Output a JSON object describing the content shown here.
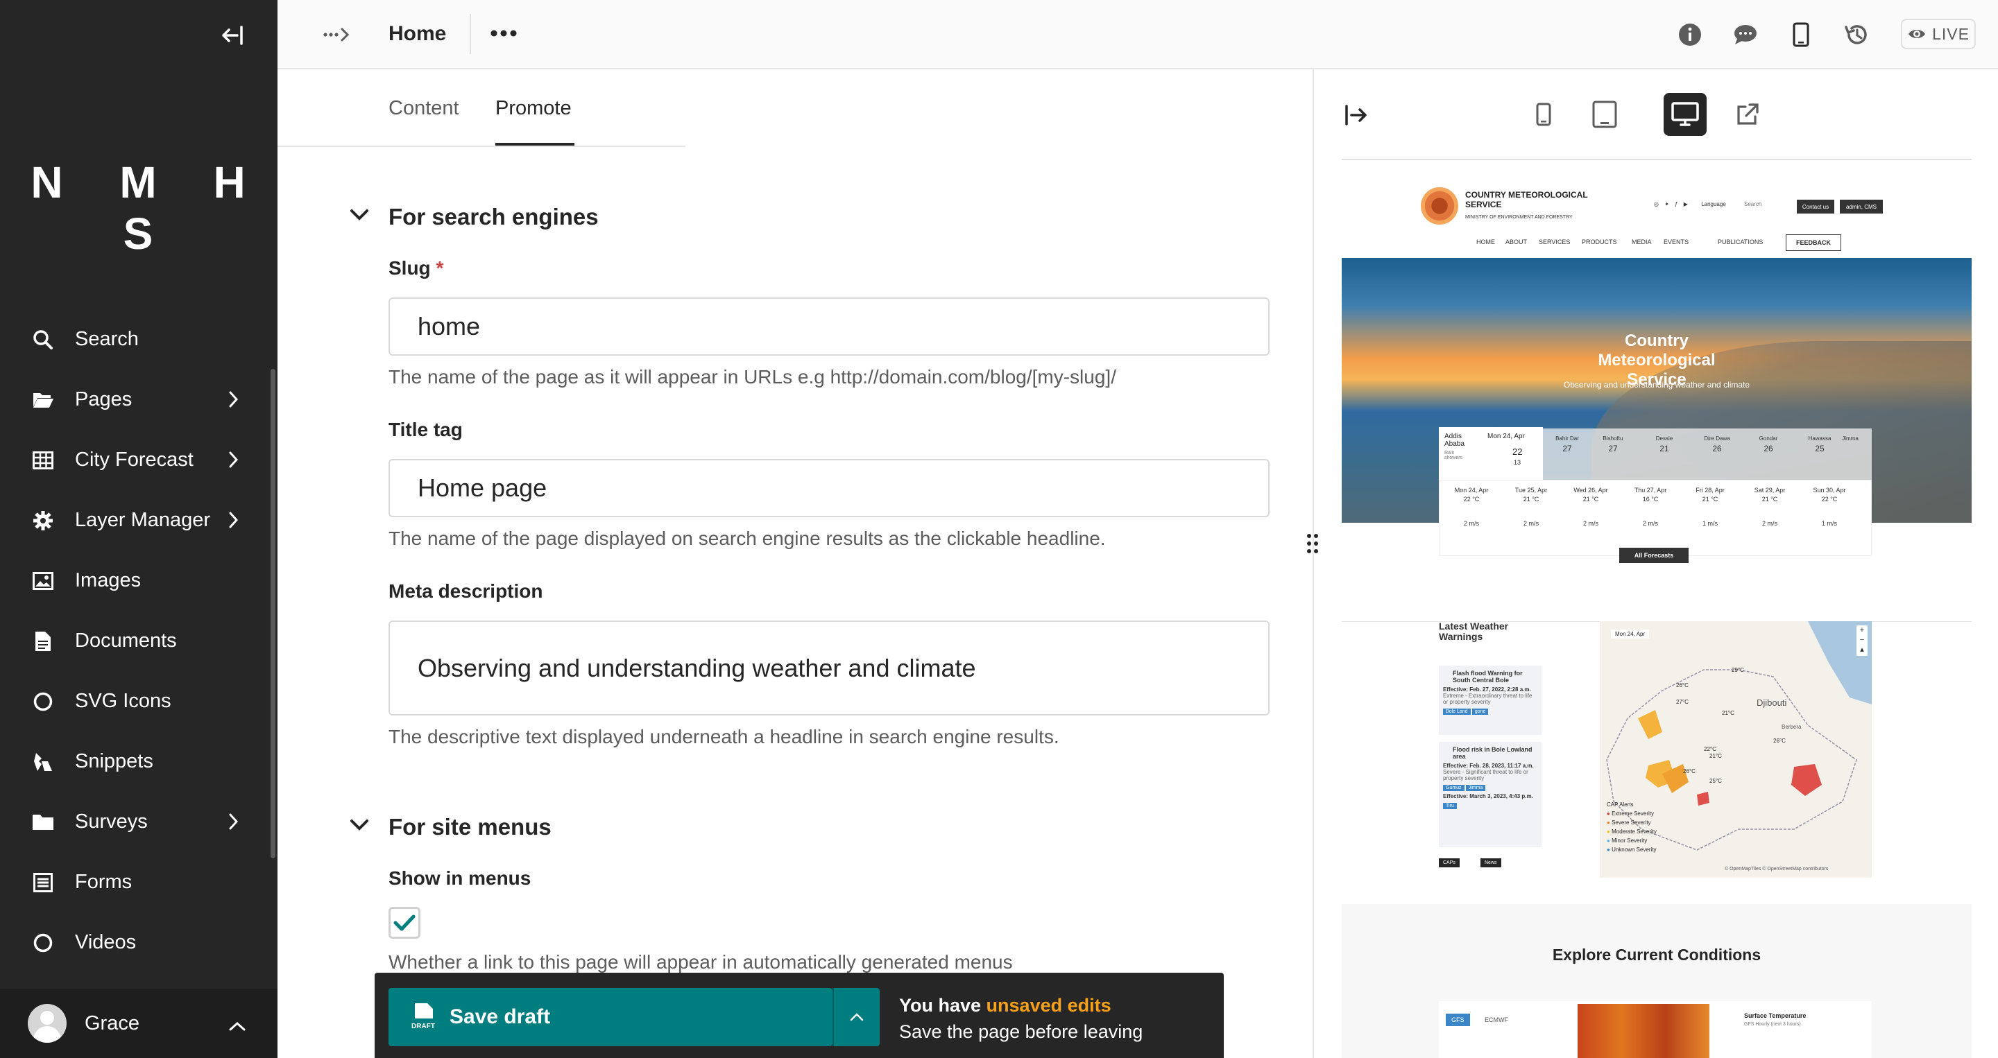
{
  "sidebar": {
    "logo": "N M H S",
    "items": [
      {
        "label": "Search",
        "icon": "search-icon",
        "has_children": false
      },
      {
        "label": "Pages",
        "icon": "folder-open-icon",
        "has_children": true
      },
      {
        "label": "City Forecast",
        "icon": "table-icon",
        "has_children": true
      },
      {
        "label": "Layer Manager",
        "icon": "cog-icon",
        "has_children": true
      },
      {
        "label": "Images",
        "icon": "image-icon",
        "has_children": false
      },
      {
        "label": "Documents",
        "icon": "doc-icon",
        "has_children": false
      },
      {
        "label": "SVG Icons",
        "icon": "circle-icon",
        "has_children": false
      },
      {
        "label": "Snippets",
        "icon": "snippet-icon",
        "has_children": false
      },
      {
        "label": "Surveys",
        "icon": "folder-icon",
        "has_children": true
      },
      {
        "label": "Forms",
        "icon": "form-icon",
        "has_children": false
      },
      {
        "label": "Videos",
        "icon": "circle-icon",
        "has_children": false
      }
    ],
    "account": {
      "name": "Grace"
    }
  },
  "header": {
    "title": "Home",
    "live_label": "LIVE"
  },
  "tabs": {
    "content": "Content",
    "promote": "Promote",
    "active": "Promote"
  },
  "sections": {
    "search": {
      "heading": "For search engines",
      "slug": {
        "label": "Slug",
        "required_mark": "*",
        "value": "home",
        "help": "The name of the page as it will appear in URLs e.g http://domain.com/blog/[my-slug]/"
      },
      "title_tag": {
        "label": "Title tag",
        "value": "Home page",
        "help": "The name of the page displayed on search engine results as the clickable headline."
      },
      "meta": {
        "label": "Meta description",
        "value": "Observing and understanding weather and climate",
        "help": "The descriptive text displayed underneath a headline in search engine results."
      }
    },
    "menus": {
      "heading": "For site menus",
      "show_in_menus": {
        "label": "Show in menus",
        "checked": true,
        "help": "Whether a link to this page will appear in automatically generated menus"
      }
    }
  },
  "footer": {
    "save_label": "Save draft",
    "draft_icon_text": "DRAFT",
    "notice_prefix": "You have ",
    "notice_highlight": "unsaved edits",
    "notice_sub": "Save the page before leaving",
    "highlight_color": "#f7a01b"
  },
  "preview": {
    "active_device": "desktop",
    "site": {
      "brand": "COUNTRY METEOROLOGICAL SERVICE",
      "brand_sub": "MINISTRY OF ENVIRONMENT AND FORESTRY",
      "language": "Language",
      "search": "Search",
      "contact": "Contact us",
      "admin": "admin, CMS",
      "nav": [
        "HOME",
        "ABOUT",
        "SERVICES",
        "PRODUCTS",
        "MEDIA",
        "EVENTS",
        "PUBLICATIONS"
      ],
      "feedback": "FEEDBACK",
      "hero_title": "Country Meteorological Service",
      "hero_sub": "Observing and understanding weather and climate",
      "today": {
        "city": "Addis Ababa",
        "cond": "Rain showers",
        "date": "Mon 24, Apr",
        "hi": "22",
        "lo": "13"
      },
      "cities": [
        {
          "name": "Bahir Dar",
          "t": "27"
        },
        {
          "name": "Bishoftu",
          "t": "27"
        },
        {
          "name": "Dessie",
          "t": "21"
        },
        {
          "name": "Dire Dawa",
          "t": "26"
        },
        {
          "name": "Gondar",
          "t": "26"
        },
        {
          "name": "Hawassa",
          "t": "25"
        },
        {
          "name": "Jimma",
          "t": ""
        }
      ],
      "week": [
        {
          "day": "Mon 24, Apr",
          "t": "22 °C",
          "w": "2 m/s"
        },
        {
          "day": "Tue 25, Apr",
          "t": "21 °C",
          "w": "2 m/s"
        },
        {
          "day": "Wed 26, Apr",
          "t": "21 °C",
          "w": "2 m/s"
        },
        {
          "day": "Thu 27, Apr",
          "t": "16 °C",
          "w": "2 m/s"
        },
        {
          "day": "Fri 28, Apr",
          "t": "21 °C",
          "w": "1 m/s"
        },
        {
          "day": "Sat 29, Apr",
          "t": "21 °C",
          "w": "2 m/s"
        },
        {
          "day": "Sun 30, Apr",
          "t": "22 °C",
          "w": "1 m/s"
        }
      ],
      "all_forecasts": "All Forecasts",
      "warnings_title": "Latest Weather Warnings",
      "warning1": {
        "title": "Flash flood Warning for South Central Bole",
        "effective": "Effective: Feb. 27, 2022, 2:28 a.m.",
        "desc": "Extreme - Extraordinary threat to life or property severity",
        "tags": [
          "Bole Land",
          "gone"
        ]
      },
      "warning2": {
        "title": "Flood risk in Bole Lowland area",
        "effective": "Effective: Feb. 28, 2023, 11:17 a.m.",
        "desc": "Severe - Significant threat to life or property severity",
        "tags": [
          "Gumuz",
          "Jimma"
        ],
        "effective2": "Effective: March 3, 2023, 4:43 p.m.",
        "tag3": "Tiru"
      },
      "warn_tabs": [
        "CAPs",
        "News"
      ],
      "map_date": "Mon 24, Apr",
      "map_labels": [
        "29°C",
        "26°C",
        "27°C",
        "21°C",
        "22°C",
        "21°C",
        "26°C",
        "25°C",
        "26°C",
        "Djibouti",
        "Berbera"
      ],
      "cap_alerts": {
        "title": "CAP Alerts",
        "items": [
          "Extreme Severity",
          "Severe Severity",
          "Moderate Severity",
          "Minor Severity",
          "Unknown Severity"
        ]
      },
      "map_attrib": "© OpenMapTiles © OpenStreetMap contributors",
      "explore_title": "Explore Current Conditions",
      "explore_tabs": [
        "GFS",
        "ECMWF"
      ],
      "explore_right": "Surface Temperature",
      "explore_right_sub": "GFS Hourly (next 3 hours)"
    }
  },
  "colors": {
    "sidebar_bg": "#262626",
    "primary": "#007d7e",
    "warning": "#f7a01b"
  }
}
